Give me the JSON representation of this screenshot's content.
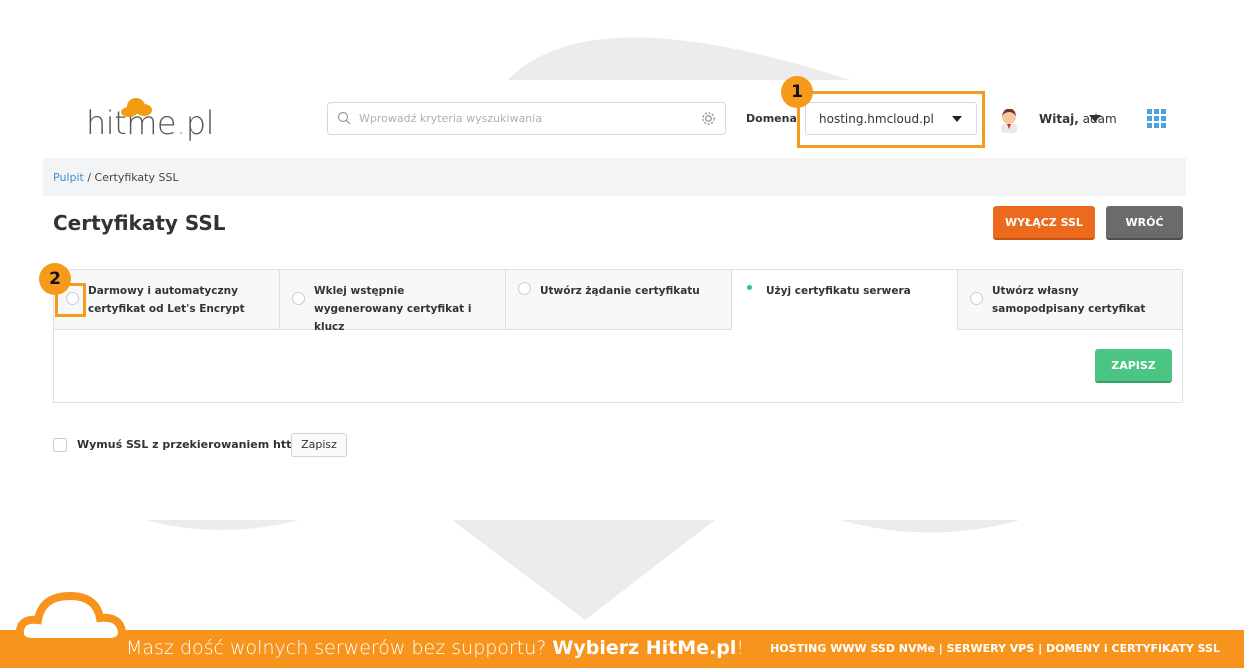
{
  "logo": {
    "text_main": "hitme",
    "text_dot": ".",
    "text_tld": "pl"
  },
  "search": {
    "placeholder": "Wprowadź kryteria wyszukiwania"
  },
  "header": {
    "domain_label": "Domena",
    "domain_value": "hosting.hmcloud.pl",
    "greeting_bold": "Witaj,",
    "greeting_user": " adam"
  },
  "annotations": {
    "badge1": "1",
    "badge2": "2"
  },
  "breadcrumb": {
    "home": "Pulpit",
    "separator": " / ",
    "current": "Certyfikaty SSL"
  },
  "page": {
    "title": "Certyfikaty SSL",
    "disable_ssl": "WYŁĄCZ SSL",
    "back": "WRÓĆ"
  },
  "tabs": [
    {
      "label": "Darmowy i automatyczny certyfikat od Let's Encrypt",
      "selected": false
    },
    {
      "label": "Wklej wstępnie wygenerowany certyfikat i klucz",
      "selected": false
    },
    {
      "label": "Utwórz żądanie certyfikatu",
      "selected": false
    },
    {
      "label": "Użyj certyfikatu serwera",
      "selected": true
    },
    {
      "label": "Utwórz własny samopodpisany certyfikat",
      "selected": false
    }
  ],
  "save_button": "ZAPISZ",
  "force_ssl": {
    "label": "Wymuś SSL z przekierowaniem https",
    "checked": false,
    "save": "Zapisz"
  },
  "footer": {
    "left_text": "Masz dość wolnych serwerów bez supportu? ",
    "left_bold": "Wybierz HitMe.pl",
    "left_end": "!",
    "right_text": "HOSTING WWW SSD NVMe | SERWERY VPS | DOMENY i CERTYFIKATY SSL"
  },
  "colors": {
    "accent": "#f59a1b",
    "orange_button": "#ec6a1e",
    "green_button": "#4bc584",
    "link": "#3f8fd2"
  }
}
